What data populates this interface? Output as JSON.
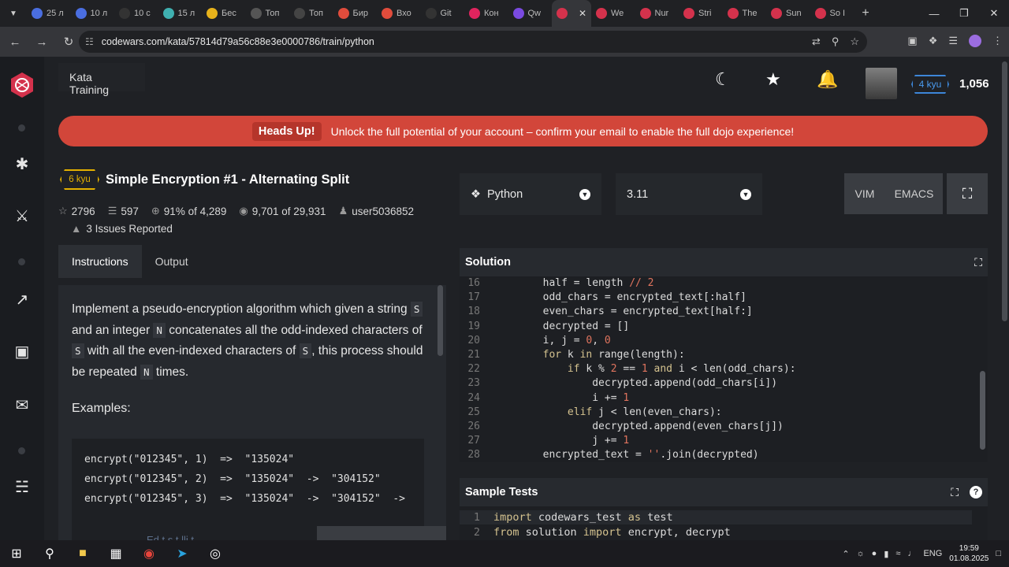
{
  "browser": {
    "tabs": [
      {
        "label": "25 л",
        "color": "#4a6ee0"
      },
      {
        "label": "10 л",
        "color": "#4a6ee0"
      },
      {
        "label": "10 с",
        "color": "#333"
      },
      {
        "label": "15 л",
        "color": "#3fb0b0"
      },
      {
        "label": "Бес",
        "color": "#e7b21b"
      },
      {
        "label": "Топ",
        "color": "#555"
      },
      {
        "label": "Топ",
        "color": "#444"
      },
      {
        "label": "Бир",
        "color": "#e04c3c"
      },
      {
        "label": "Вхо",
        "color": "#e04c3c"
      },
      {
        "label": "Git",
        "color": "#333"
      },
      {
        "label": "Кон",
        "color": "#e0245e"
      },
      {
        "label": "Qw",
        "color": "#7a4ae0"
      },
      {
        "label": "",
        "color": "#d4324c"
      },
      {
        "label": "We",
        "color": "#d4324c"
      },
      {
        "label": "Nur",
        "color": "#d4324c"
      },
      {
        "label": "Stri",
        "color": "#d4324c"
      },
      {
        "label": "The",
        "color": "#d4324c"
      },
      {
        "label": "Sun",
        "color": "#d4324c"
      },
      {
        "label": "So I",
        "color": "#d4324c"
      }
    ],
    "url": "codewars.com/kata/57814d79a56c88e3e0000786/train/python"
  },
  "header": {
    "section_label": "Kata Training",
    "user_rank": "4 kyu",
    "honor": "1,056"
  },
  "banner": {
    "heads_up": "Heads Up!",
    "message": "Unlock the full potential of your account – confirm your email to enable the full dojo experience!"
  },
  "kata": {
    "rank": "6 kyu",
    "title": "Simple Encryption #1 - Alternating Split",
    "stars": "2796",
    "collections": "597",
    "satisfaction": "91% of 4,289",
    "completions": "9,701 of 29,931",
    "author": "user5036852",
    "issues": "3 Issues Reported"
  },
  "left_tabs": [
    "Instructions",
    "Output"
  ],
  "instructions": {
    "p_1": "Implement a pseudo-encryption algorithm which given a string ",
    "code_s": "S",
    "p_2": " and an integer ",
    "code_n": "N",
    "p_3": " concatenates all the odd-indexed characters of ",
    "code_s2": "S",
    "p_4": " with all the even-indexed characters of ",
    "code_s3": "S",
    "p_5": ", this process should be repeated ",
    "code_n2": "N",
    "p_6": " times.",
    "examples_heading": "Examples:",
    "examples": "encrypt(\"012345\", 1)  =>  \"135024\"\nencrypt(\"012345\", 2)  =>  \"135024\"  ->  \"304152\"\nencrypt(\"012345\", 3)  =>  \"135024\"  ->  \"304152\"  ->",
    "bottom_text": "Ed        t  s  t   lli  t"
  },
  "editor_settings": {
    "language": "Python",
    "version": "3.11",
    "vim": "VIM",
    "emacs": "EMACS"
  },
  "solution": {
    "title": "Solution",
    "lines": [
      {
        "n": "16",
        "text": "        half = length // 2"
      },
      {
        "n": "17",
        "text": "        odd_chars = encrypted_text[:half]"
      },
      {
        "n": "18",
        "text": "        even_chars = encrypted_text[half:]"
      },
      {
        "n": "19",
        "text": "        decrypted = []"
      },
      {
        "n": "20",
        "text": "        i, j = 0, 0"
      },
      {
        "n": "21",
        "text": "        for k in range(length):"
      },
      {
        "n": "22",
        "text": "            if k % 2 == 1 and i < len(odd_chars):"
      },
      {
        "n": "23",
        "text": "                decrypted.append(odd_chars[i])"
      },
      {
        "n": "24",
        "text": "                i += 1"
      },
      {
        "n": "25",
        "text": "            elif j < len(even_chars):"
      },
      {
        "n": "26",
        "text": "                decrypted.append(even_chars[j])"
      },
      {
        "n": "27",
        "text": "                j += 1"
      },
      {
        "n": "28",
        "text": "        encrypted_text = ''.join(decrypted)"
      }
    ]
  },
  "tests": {
    "title": "Sample Tests",
    "help": "?",
    "lines": [
      {
        "n": "1",
        "text": "import codewars_test as test"
      },
      {
        "n": "2",
        "text": "from solution import encrypt, decrypt"
      }
    ]
  },
  "taskbar": {
    "lang": "ENG",
    "time": "19:59",
    "date": "01.08.2025"
  }
}
